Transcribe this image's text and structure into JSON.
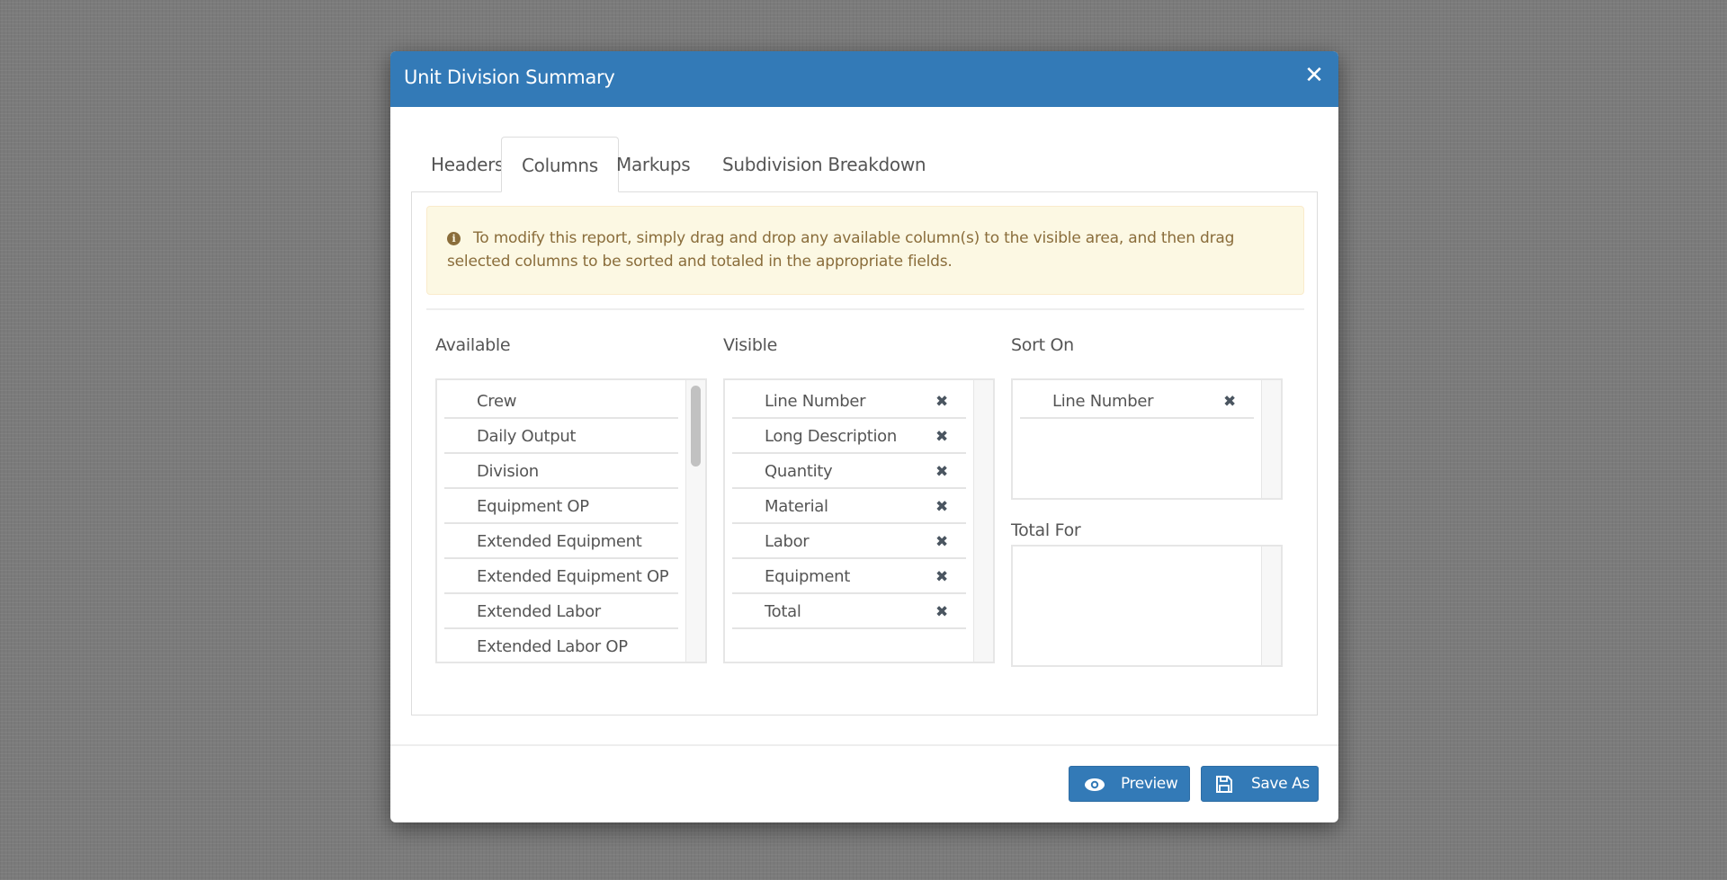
{
  "dialog": {
    "title": "Unit Division Summary",
    "close_icon": "close-icon",
    "close_glyph": "✕"
  },
  "tabs": [
    {
      "label": "Headers",
      "active": false
    },
    {
      "label": "Columns",
      "active": true
    },
    {
      "label": "Markups",
      "active": false
    },
    {
      "label": "Subdivision Breakdown",
      "active": false
    }
  ],
  "alert": {
    "icon": "info-circle-icon",
    "icon_glyph": "i",
    "text": "To modify this report, simply drag and drop any available column(s) to the visible area, and then drag selected columns to be sorted and totaled in the appropriate fields."
  },
  "columns": {
    "available": {
      "label": "Available",
      "items": [
        "Crew",
        "Daily Output",
        "Division",
        "Equipment OP",
        "Extended Equipment",
        "Extended Equipment OP",
        "Extended Labor",
        "Extended Labor OP"
      ]
    },
    "visible": {
      "label": "Visible",
      "items": [
        "Line Number",
        "Long Description",
        "Quantity",
        "Material",
        "Labor",
        "Equipment",
        "Total"
      ]
    },
    "sort_on": {
      "label": "Sort On",
      "items": [
        "Line Number"
      ]
    },
    "total_for": {
      "label": "Total For",
      "items": []
    },
    "remove_glyph": "✖"
  },
  "footer": {
    "preview_label": "Preview",
    "preview_icon": "eye-icon",
    "save_as_label": "Save As",
    "save_as_icon": "floppy-disk-icon"
  },
  "colors": {
    "primary": "#337ab7",
    "alert_bg": "#fcf8e3",
    "alert_text": "#8a6d3b",
    "backdrop": "#7b7b7b"
  }
}
